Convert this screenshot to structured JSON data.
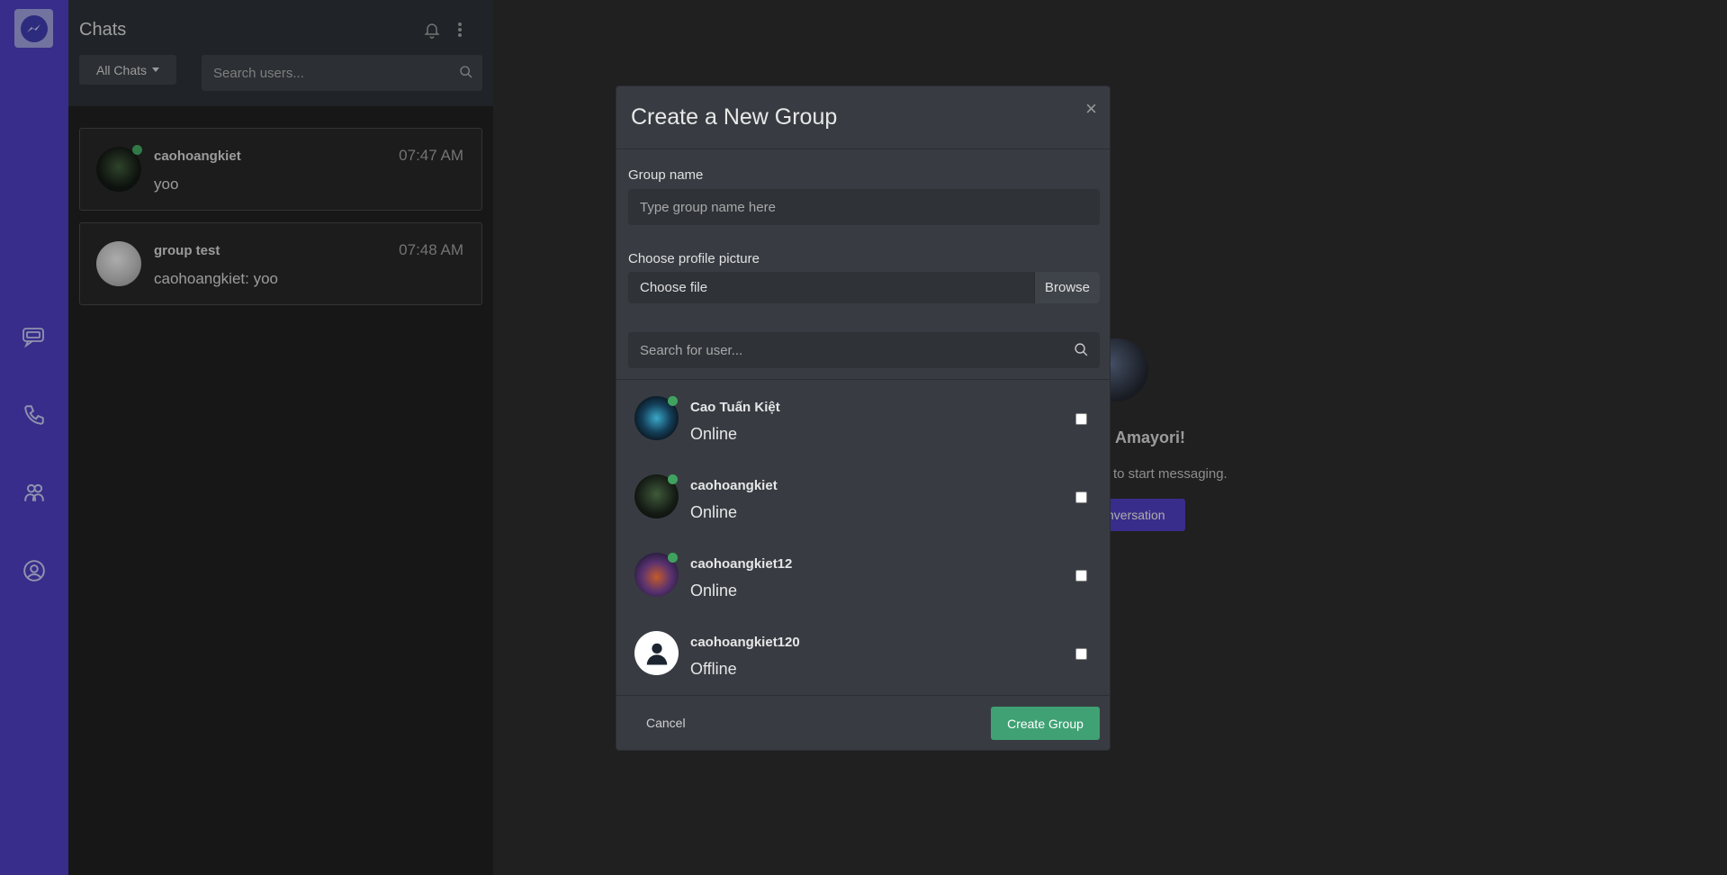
{
  "chats_panel": {
    "title": "Chats",
    "filter_label": "All Chats",
    "search_placeholder": "Search users...",
    "items": [
      {
        "name": "caohoangkiet",
        "time": "07:47 AM",
        "message": "yoo",
        "online": true
      },
      {
        "name": "group test",
        "time": "07:48 AM",
        "message": "caohoangkiet: yoo",
        "online": false
      }
    ]
  },
  "background": {
    "welcome_fragment": "Amayori!",
    "sub_fragment": "to start messaging.",
    "button_fragment": "nversation"
  },
  "modal": {
    "title": "Create a New Group",
    "close_symbol": "×",
    "group_name_label": "Group name",
    "group_name_placeholder": "Type group name here",
    "picture_label": "Choose profile picture",
    "file_text": "Choose file",
    "browse_label": "Browse",
    "user_search_placeholder": "Search for user...",
    "users": [
      {
        "name": "Cao Tuấn Kiệt",
        "status": "Online"
      },
      {
        "name": "caohoangkiet",
        "status": "Online"
      },
      {
        "name": "caohoangkiet12",
        "status": "Online"
      },
      {
        "name": "caohoangkiet120",
        "status": "Offline"
      }
    ],
    "cancel_label": "Cancel",
    "create_label": "Create Group"
  },
  "colors": {
    "rail": "#4b3db8",
    "online": "#3fa35f",
    "create_button": "#3fa174"
  }
}
